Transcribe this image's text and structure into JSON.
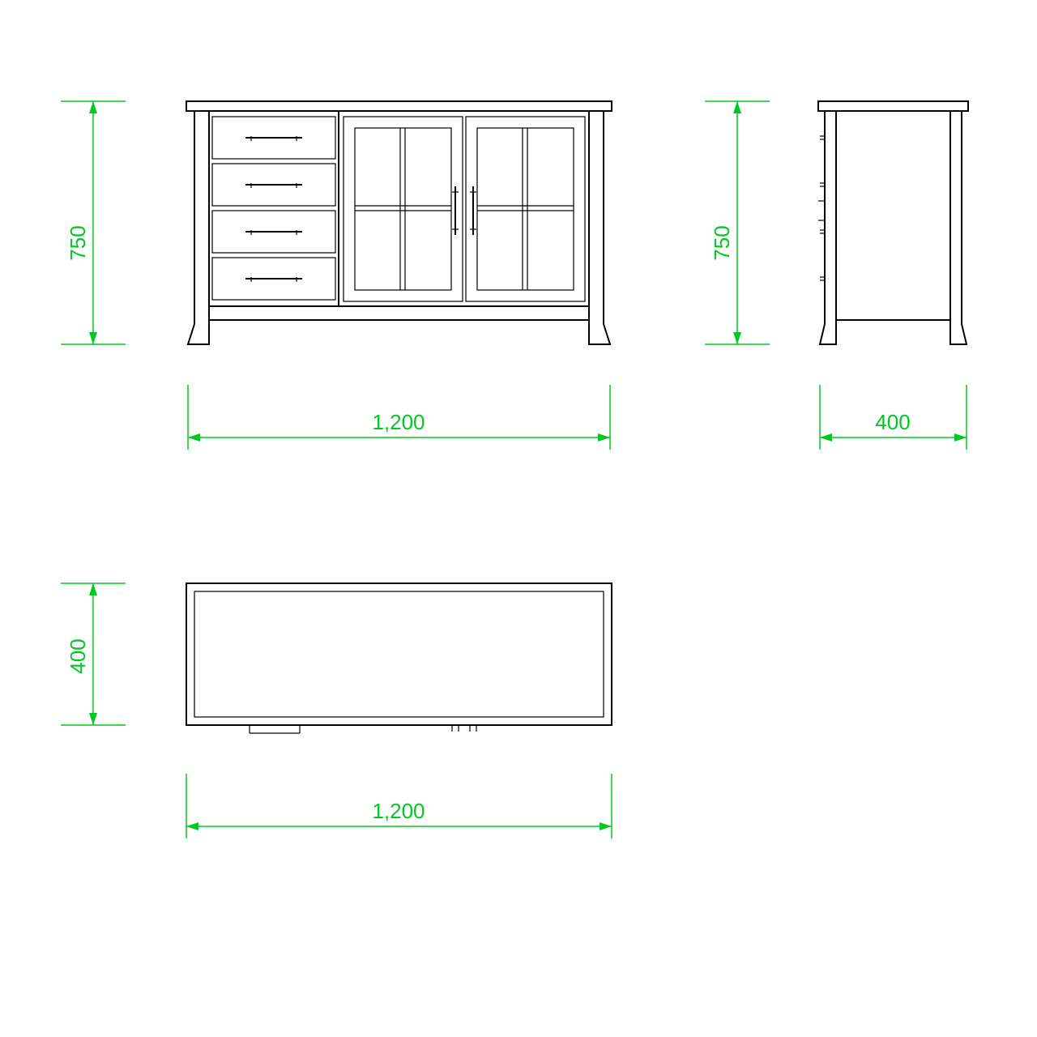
{
  "colors": {
    "dimension": "#00c820",
    "object": "#000000",
    "background": "#ffffff"
  },
  "dimensions": {
    "front_height": "750",
    "front_width": "1,200",
    "side_height": "750",
    "side_width": "400",
    "top_height": "400",
    "top_width": "1,200"
  },
  "views": {
    "front": {
      "width_mm": 1200,
      "height_mm": 750
    },
    "side": {
      "width_mm": 400,
      "height_mm": 750
    },
    "top": {
      "width_mm": 1200,
      "height_mm": 400
    }
  }
}
